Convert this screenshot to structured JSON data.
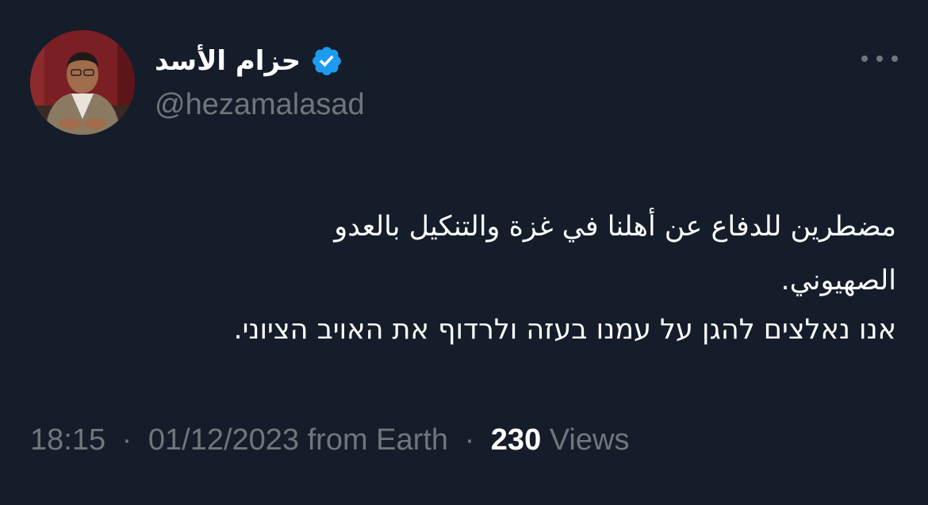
{
  "author": {
    "display_name": "حزام الأسد",
    "handle": "@hezamalasad",
    "verified": true
  },
  "tweet": {
    "lines": [
      "مضطرين للدفاع عن أهلنا في غزة والتنكيل بالعدو",
      "الصهيوني.",
      "אנו נאלצים להגן על עמנו בעזה ולרדוף את האויב הציוני."
    ]
  },
  "meta": {
    "time": "18:15",
    "separator": "·",
    "date": "01/12/2023",
    "source": "from Earth",
    "views_count": "230",
    "views_label": "Views"
  },
  "icons": {
    "verified": "verified-badge-icon",
    "more": "more-options-icon"
  },
  "colors": {
    "background": "#151d2a",
    "verified": "#1d9bf0",
    "secondary_text": "#71767b"
  }
}
